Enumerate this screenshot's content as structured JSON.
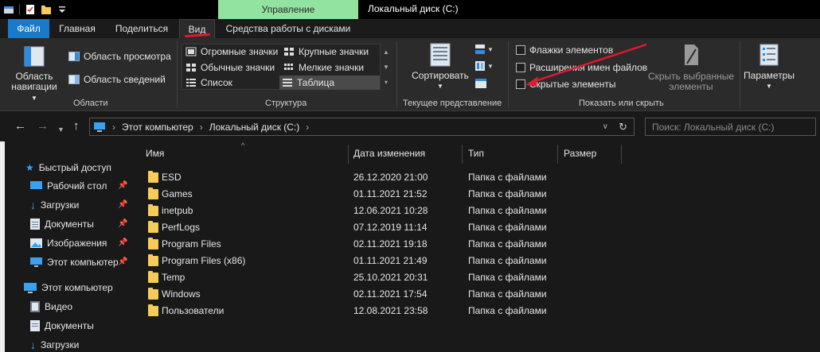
{
  "titlebar": {
    "context_tab": "Управление",
    "window_title": "Локальный диск (C:)"
  },
  "tabs": {
    "file": "Файл",
    "home": "Главная",
    "share": "Поделиться",
    "view": "Вид",
    "disk_tools": "Средства работы с дисками"
  },
  "ribbon": {
    "panes": {
      "nav_pane_line1": "Область",
      "nav_pane_line2": "навигации",
      "preview_pane": "Область просмотра",
      "details_pane": "Область сведений",
      "label": "Области"
    },
    "layout": {
      "extra_large": "Огромные значки",
      "large": "Крупные значки",
      "medium": "Обычные значки",
      "small": "Мелкие значки",
      "list": "Список",
      "details": "Таблица",
      "label": "Структура"
    },
    "current_view": {
      "sort": "Сортировать",
      "label": "Текущее представление"
    },
    "show_hide": {
      "item_checkboxes": "Флажки элементов",
      "file_extensions": "Расширения имен файлов",
      "hidden_items": "Скрытые элементы",
      "hide_selected_line1": "Скрыть выбранные",
      "hide_selected_line2": "элементы",
      "label": "Показать или скрыть"
    },
    "options": "Параметры"
  },
  "address": {
    "crumb1": "Этот компьютер",
    "crumb2": "Локальный диск (C:)",
    "search_placeholder": "Поиск: Локальный диск (C:)"
  },
  "navpane": {
    "quick_access": "Быстрый доступ",
    "items": [
      {
        "label": "Рабочий стол"
      },
      {
        "label": "Загрузки"
      },
      {
        "label": "Документы"
      },
      {
        "label": "Изображения"
      },
      {
        "label": "Этот компьютер"
      }
    ],
    "this_pc": "Этот компьютер",
    "pc_items": [
      {
        "label": "Видео"
      },
      {
        "label": "Документы"
      },
      {
        "label": "Загрузки"
      }
    ]
  },
  "columns": {
    "name": "Имя",
    "modified": "Дата изменения",
    "type": "Тип",
    "size": "Размер"
  },
  "files": [
    {
      "name": "ESD",
      "modified": "26.12.2020 21:00",
      "type": "Папка с файлами"
    },
    {
      "name": "Games",
      "modified": "01.11.2021 21:52",
      "type": "Папка с файлами"
    },
    {
      "name": "inetpub",
      "modified": "12.06.2021 10:28",
      "type": "Папка с файлами"
    },
    {
      "name": "PerfLogs",
      "modified": "07.12.2019 11:14",
      "type": "Папка с файлами"
    },
    {
      "name": "Program Files",
      "modified": "02.11.2021 19:18",
      "type": "Папка с файлами"
    },
    {
      "name": "Program Files (x86)",
      "modified": "01.11.2021 21:49",
      "type": "Папка с файлами"
    },
    {
      "name": "Temp",
      "modified": "25.10.2021 20:31",
      "type": "Папка с файлами"
    },
    {
      "name": "Windows",
      "modified": "02.11.2021 17:54",
      "type": "Папка с файлами"
    },
    {
      "name": "Пользователи",
      "modified": "12.08.2021 23:58",
      "type": "Папка с файлами"
    }
  ],
  "colors": {
    "accent": "#1979ca",
    "context_tab": "#92e2a0",
    "annotation_red": "#e3192f",
    "folder": "#f6cb58"
  }
}
